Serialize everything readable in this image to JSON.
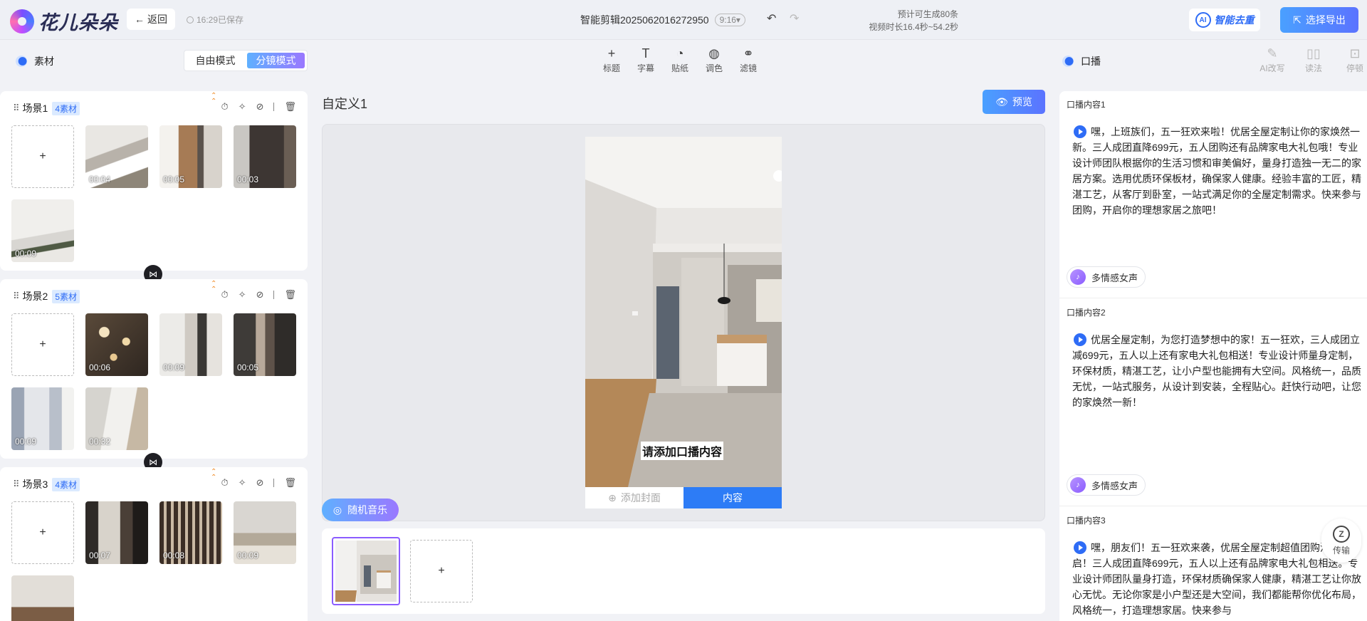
{
  "header": {
    "logo_text": "花儿朵朵",
    "back_label": "返回",
    "saved_text": "16:29已保存",
    "project_name": "智能剪辑2025062016272950",
    "ratio": "9:16▾",
    "estimate_line1": "预计可生成80条",
    "estimate_line2": "视频时长16.4秒~54.2秒",
    "ai_badge": "AI",
    "ai_brand": "智能去重",
    "export_label": "选择导出"
  },
  "toolbar": {
    "materials_label": "素材",
    "modes": [
      "自由模式",
      "分镜模式"
    ],
    "active_mode": 1,
    "tools": [
      {
        "icon": "plus-icon",
        "glyph": "+",
        "label": "标题"
      },
      {
        "icon": "text-icon",
        "glyph": "T",
        "label": "字幕"
      },
      {
        "icon": "sticker-icon",
        "glyph": "◔",
        "label": "贴纸"
      },
      {
        "icon": "palette-icon",
        "glyph": "◍",
        "label": "调色"
      },
      {
        "icon": "filter-icon",
        "glyph": "⚭",
        "label": "滤镜"
      }
    ],
    "voiceover_label": "口播",
    "right_tools": [
      {
        "icon": "ai-rewrite-icon",
        "glyph": "✎",
        "label": "AI改写"
      },
      {
        "icon": "read-icon",
        "glyph": "📖",
        "label": "读法"
      },
      {
        "icon": "pause-icon",
        "glyph": "⏸",
        "label": "停顿"
      }
    ]
  },
  "scenes": [
    {
      "name": "场景1",
      "count": "4素材",
      "clips": [
        "00:04",
        "00:05",
        "00:03",
        "00:09"
      ]
    },
    {
      "name": "场景2",
      "count": "5素材",
      "clips": [
        "00:06",
        "00:09",
        "00:05",
        "00:09",
        "00:32"
      ]
    },
    {
      "name": "场景3",
      "count": "4素材",
      "clips": [
        "00:07",
        "00:08",
        "00:09",
        ""
      ]
    }
  ],
  "center": {
    "title": "自定义1",
    "preview_label": "预览",
    "caption": "请添加口播内容",
    "add_cover": "添加封面",
    "content_tab": "内容",
    "music_label": "随机音乐"
  },
  "voiceover": [
    {
      "title": "口播内容1",
      "text": "嘿，上班族们，五一狂欢来啦！优居全屋定制让你的家焕然一新。三人成团直降699元，五人团购还有品牌家电大礼包哦！专业设计师团队根据你的生活习惯和审美偏好，量身打造独一无二的家居方案。选用优质环保板材，确保家人健康。经验丰富的工匠，精湛工艺，从客厅到卧室，一站式满足你的全屋定制需求。快来参与团购，开启你的理想家居之旅吧！",
      "voice": "多情感女声"
    },
    {
      "title": "口播内容2",
      "text": "优居全屋定制，为您打造梦想中的家！五一狂欢，三人成团立减699元，五人以上还有家电大礼包相送！专业设计师量身定制，环保材质，精湛工艺，让小户型也能拥有大空间。风格统一，品质无忧，一站式服务，从设计到安装，全程贴心。赶快行动吧，让您的家焕然一新！",
      "voice": "多情感女声"
    },
    {
      "title": "口播内容3",
      "text": "嘿，朋友们！五一狂欢来袭，优居全屋定制超值团购活动开启！三人成团直降699元，五人以上还有品牌家电大礼包相送。专业设计师团队量身打造，环保材质确保家人健康，精湛工艺让你放心无忧。无论你家是小户型还是大空间，我们都能帮你优化布局，风格统一，打造理想家居。快来参与",
      "voice": ""
    }
  ],
  "upload_label": "传输"
}
